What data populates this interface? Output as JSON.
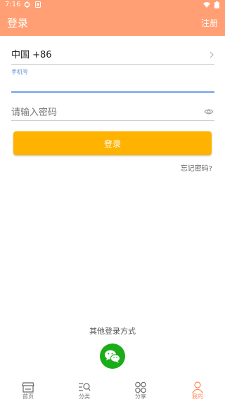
{
  "status_bar": {
    "time": "7:16"
  },
  "header": {
    "title": "登录",
    "register": "注册"
  },
  "form": {
    "country_code": "中国 +86",
    "phone_label": "手机号",
    "phone_value": "",
    "password_placeholder": "请输入密码",
    "login_label": "登录",
    "forgot_label": "忘记密码?"
  },
  "other_login": {
    "label": "其他登录方式"
  },
  "bottom_nav": {
    "items": [
      {
        "label": "首页",
        "icon": "store-icon",
        "active": false
      },
      {
        "label": "分类",
        "icon": "category-search-icon",
        "active": false
      },
      {
        "label": "分享",
        "icon": "grid-icon",
        "active": false
      },
      {
        "label": "我的",
        "icon": "user-icon",
        "active": true
      }
    ]
  },
  "colors": {
    "header_bg": "#ff9f73",
    "button_bg": "#ffb300",
    "active_tab": "#ff8a5b",
    "wechat": "#1aad19",
    "focus_line": "#6fa0e6"
  }
}
